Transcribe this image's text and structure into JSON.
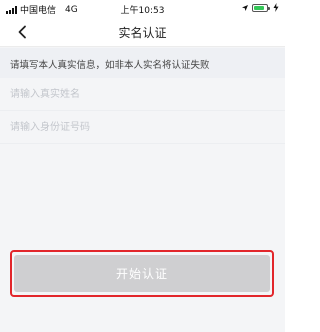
{
  "status_bar": {
    "carrier": "中国电信",
    "network": "4G",
    "time": "上午10:53",
    "battery_percent": 85
  },
  "nav": {
    "title": "实名认证"
  },
  "notice": {
    "text": "请填写本人真实信息，如非本人实名将认证失败"
  },
  "form": {
    "name_placeholder": "请输入真实姓名",
    "id_placeholder": "请输入身份证号码"
  },
  "actions": {
    "start_label": "开始认证"
  },
  "colors": {
    "highlight": "#e2262b",
    "button_disabled": "#cfcfd1",
    "battery": "#35c759"
  }
}
